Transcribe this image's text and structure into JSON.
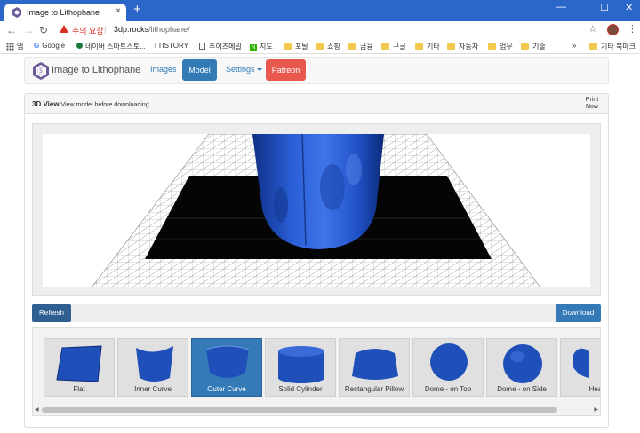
{
  "browser": {
    "tab_title": "Image to Lithophane",
    "tab_close": "×",
    "new_tab": "+",
    "back": "←",
    "forward": "→",
    "reload": "↻",
    "security_text": "주의 요함",
    "separator": "|",
    "url_host": "3dp.rocks",
    "url_path": "/lithophane/",
    "star": "☆",
    "menu": "⋮",
    "minimize": "—",
    "maximize": "☐",
    "close": "✕",
    "bookmarks": [
      "앱",
      "Google",
      "네이버 스마트스토...",
      "TISTORY",
      "추이즈메일",
      "지도",
      "포탈",
      "쇼핑",
      "금융",
      "구글",
      "기타",
      "자동차",
      "업무",
      "기술"
    ],
    "bookmarks_more": "»",
    "other_bookmarks": "기타 북마크"
  },
  "navbar": {
    "brand": "Image to Lithophane",
    "links": {
      "images": "Images",
      "model": "Model",
      "settings": "Settings",
      "patreon": "Patreon"
    }
  },
  "panel": {
    "title": "3D View",
    "subtitle": "View model before downloading",
    "print_now": "Print Now",
    "refresh": "Refresh",
    "download": "Download"
  },
  "shapes": [
    {
      "label": "Flat",
      "active": false
    },
    {
      "label": "Inner Curve",
      "active": false
    },
    {
      "label": "Outer Curve",
      "active": true
    },
    {
      "label": "Solid Cylinder",
      "active": false
    },
    {
      "label": "Rectangular Pillow",
      "active": false
    },
    {
      "label": "Dome - on Top",
      "active": false
    },
    {
      "label": "Dome - on Side",
      "active": false
    },
    {
      "label": "Hea",
      "active": false
    }
  ],
  "colors": {
    "model_blue": "#1f4fb8",
    "accent": "#337ab7",
    "patreon": "#e9584f",
    "chrome_blue": "#2b67c9"
  }
}
